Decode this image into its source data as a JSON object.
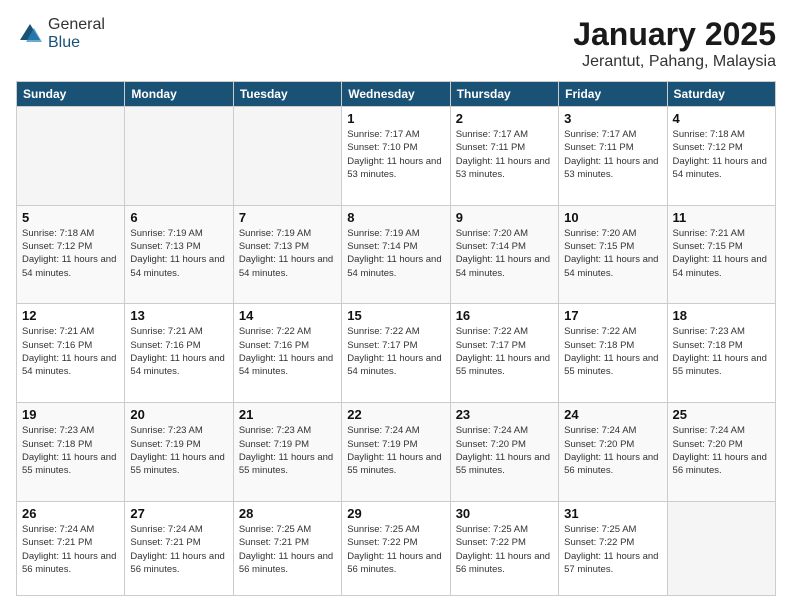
{
  "header": {
    "logo_general": "General",
    "logo_blue": "Blue",
    "title": "January 2025",
    "subtitle": "Jerantut, Pahang, Malaysia"
  },
  "days_of_week": [
    "Sunday",
    "Monday",
    "Tuesday",
    "Wednesday",
    "Thursday",
    "Friday",
    "Saturday"
  ],
  "weeks": [
    [
      {
        "day": "",
        "sunrise": "",
        "sunset": "",
        "daylight": "",
        "empty": true
      },
      {
        "day": "",
        "sunrise": "",
        "sunset": "",
        "daylight": "",
        "empty": true
      },
      {
        "day": "",
        "sunrise": "",
        "sunset": "",
        "daylight": "",
        "empty": true
      },
      {
        "day": "1",
        "sunrise": "Sunrise: 7:17 AM",
        "sunset": "Sunset: 7:10 PM",
        "daylight": "Daylight: 11 hours and 53 minutes."
      },
      {
        "day": "2",
        "sunrise": "Sunrise: 7:17 AM",
        "sunset": "Sunset: 7:11 PM",
        "daylight": "Daylight: 11 hours and 53 minutes."
      },
      {
        "day": "3",
        "sunrise": "Sunrise: 7:17 AM",
        "sunset": "Sunset: 7:11 PM",
        "daylight": "Daylight: 11 hours and 53 minutes."
      },
      {
        "day": "4",
        "sunrise": "Sunrise: 7:18 AM",
        "sunset": "Sunset: 7:12 PM",
        "daylight": "Daylight: 11 hours and 54 minutes."
      }
    ],
    [
      {
        "day": "5",
        "sunrise": "Sunrise: 7:18 AM",
        "sunset": "Sunset: 7:12 PM",
        "daylight": "Daylight: 11 hours and 54 minutes."
      },
      {
        "day": "6",
        "sunrise": "Sunrise: 7:19 AM",
        "sunset": "Sunset: 7:13 PM",
        "daylight": "Daylight: 11 hours and 54 minutes."
      },
      {
        "day": "7",
        "sunrise": "Sunrise: 7:19 AM",
        "sunset": "Sunset: 7:13 PM",
        "daylight": "Daylight: 11 hours and 54 minutes."
      },
      {
        "day": "8",
        "sunrise": "Sunrise: 7:19 AM",
        "sunset": "Sunset: 7:14 PM",
        "daylight": "Daylight: 11 hours and 54 minutes."
      },
      {
        "day": "9",
        "sunrise": "Sunrise: 7:20 AM",
        "sunset": "Sunset: 7:14 PM",
        "daylight": "Daylight: 11 hours and 54 minutes."
      },
      {
        "day": "10",
        "sunrise": "Sunrise: 7:20 AM",
        "sunset": "Sunset: 7:15 PM",
        "daylight": "Daylight: 11 hours and 54 minutes."
      },
      {
        "day": "11",
        "sunrise": "Sunrise: 7:21 AM",
        "sunset": "Sunset: 7:15 PM",
        "daylight": "Daylight: 11 hours and 54 minutes."
      }
    ],
    [
      {
        "day": "12",
        "sunrise": "Sunrise: 7:21 AM",
        "sunset": "Sunset: 7:16 PM",
        "daylight": "Daylight: 11 hours and 54 minutes."
      },
      {
        "day": "13",
        "sunrise": "Sunrise: 7:21 AM",
        "sunset": "Sunset: 7:16 PM",
        "daylight": "Daylight: 11 hours and 54 minutes."
      },
      {
        "day": "14",
        "sunrise": "Sunrise: 7:22 AM",
        "sunset": "Sunset: 7:16 PM",
        "daylight": "Daylight: 11 hours and 54 minutes."
      },
      {
        "day": "15",
        "sunrise": "Sunrise: 7:22 AM",
        "sunset": "Sunset: 7:17 PM",
        "daylight": "Daylight: 11 hours and 54 minutes."
      },
      {
        "day": "16",
        "sunrise": "Sunrise: 7:22 AM",
        "sunset": "Sunset: 7:17 PM",
        "daylight": "Daylight: 11 hours and 55 minutes."
      },
      {
        "day": "17",
        "sunrise": "Sunrise: 7:22 AM",
        "sunset": "Sunset: 7:18 PM",
        "daylight": "Daylight: 11 hours and 55 minutes."
      },
      {
        "day": "18",
        "sunrise": "Sunrise: 7:23 AM",
        "sunset": "Sunset: 7:18 PM",
        "daylight": "Daylight: 11 hours and 55 minutes."
      }
    ],
    [
      {
        "day": "19",
        "sunrise": "Sunrise: 7:23 AM",
        "sunset": "Sunset: 7:18 PM",
        "daylight": "Daylight: 11 hours and 55 minutes."
      },
      {
        "day": "20",
        "sunrise": "Sunrise: 7:23 AM",
        "sunset": "Sunset: 7:19 PM",
        "daylight": "Daylight: 11 hours and 55 minutes."
      },
      {
        "day": "21",
        "sunrise": "Sunrise: 7:23 AM",
        "sunset": "Sunset: 7:19 PM",
        "daylight": "Daylight: 11 hours and 55 minutes."
      },
      {
        "day": "22",
        "sunrise": "Sunrise: 7:24 AM",
        "sunset": "Sunset: 7:19 PM",
        "daylight": "Daylight: 11 hours and 55 minutes."
      },
      {
        "day": "23",
        "sunrise": "Sunrise: 7:24 AM",
        "sunset": "Sunset: 7:20 PM",
        "daylight": "Daylight: 11 hours and 55 minutes."
      },
      {
        "day": "24",
        "sunrise": "Sunrise: 7:24 AM",
        "sunset": "Sunset: 7:20 PM",
        "daylight": "Daylight: 11 hours and 56 minutes."
      },
      {
        "day": "25",
        "sunrise": "Sunrise: 7:24 AM",
        "sunset": "Sunset: 7:20 PM",
        "daylight": "Daylight: 11 hours and 56 minutes."
      }
    ],
    [
      {
        "day": "26",
        "sunrise": "Sunrise: 7:24 AM",
        "sunset": "Sunset: 7:21 PM",
        "daylight": "Daylight: 11 hours and 56 minutes."
      },
      {
        "day": "27",
        "sunrise": "Sunrise: 7:24 AM",
        "sunset": "Sunset: 7:21 PM",
        "daylight": "Daylight: 11 hours and 56 minutes."
      },
      {
        "day": "28",
        "sunrise": "Sunrise: 7:25 AM",
        "sunset": "Sunset: 7:21 PM",
        "daylight": "Daylight: 11 hours and 56 minutes."
      },
      {
        "day": "29",
        "sunrise": "Sunrise: 7:25 AM",
        "sunset": "Sunset: 7:22 PM",
        "daylight": "Daylight: 11 hours and 56 minutes."
      },
      {
        "day": "30",
        "sunrise": "Sunrise: 7:25 AM",
        "sunset": "Sunset: 7:22 PM",
        "daylight": "Daylight: 11 hours and 56 minutes."
      },
      {
        "day": "31",
        "sunrise": "Sunrise: 7:25 AM",
        "sunset": "Sunset: 7:22 PM",
        "daylight": "Daylight: 11 hours and 57 minutes."
      },
      {
        "day": "",
        "sunrise": "",
        "sunset": "",
        "daylight": "",
        "empty": true
      }
    ]
  ]
}
